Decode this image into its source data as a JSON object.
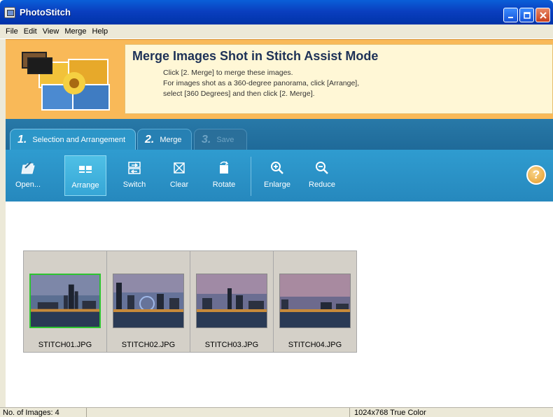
{
  "window": {
    "title": "PhotoStitch",
    "controls": [
      "minimize",
      "maximize",
      "close"
    ]
  },
  "menu": [
    "File",
    "Edit",
    "View",
    "Merge",
    "Help"
  ],
  "banner": {
    "title": "Merge Images Shot in Stitch Assist Mode",
    "lines": [
      "Click [2.  Merge] to merge these images.",
      "For images shot as a 360-degree panorama, click [Arrange],",
      "select [360 Degrees] and then click [2. Merge]."
    ]
  },
  "tabs": [
    {
      "num": "1.",
      "label": "Selection and Arrangement",
      "state": "active"
    },
    {
      "num": "2.",
      "label": "Merge",
      "state": "inactive"
    },
    {
      "num": "3.",
      "label": "Save",
      "state": "disabled"
    }
  ],
  "toolbar": {
    "tools": [
      {
        "label": "Open...",
        "icon": "open-folder-icon",
        "selected": false
      },
      {
        "label": "Arrange",
        "icon": "arrange-icon",
        "selected": true
      },
      {
        "label": "Switch",
        "icon": "switch-icon",
        "selected": false
      },
      {
        "label": "Clear",
        "icon": "clear-icon",
        "selected": false
      },
      {
        "label": "Rotate",
        "icon": "rotate-icon",
        "selected": false
      },
      {
        "label": "Enlarge",
        "icon": "zoom-in-icon",
        "selected": false
      },
      {
        "label": "Reduce",
        "icon": "zoom-out-icon",
        "selected": false
      }
    ],
    "help_label": "?"
  },
  "images": [
    {
      "filename": "STITCH01.JPG",
      "selected": true
    },
    {
      "filename": "STITCH02.JPG",
      "selected": false
    },
    {
      "filename": "STITCH03.JPG",
      "selected": false
    },
    {
      "filename": "STITCH04.JPG",
      "selected": false
    }
  ],
  "status": {
    "count": "No. of Images: 4",
    "middle": "",
    "color_info": "1024x768 True Color"
  },
  "colors": {
    "title_bar": "#0a3fc0",
    "banner_bg": "#f9b958",
    "toolbar_bg": "#2f9cd0",
    "selected_image_border": "#2ec430"
  }
}
